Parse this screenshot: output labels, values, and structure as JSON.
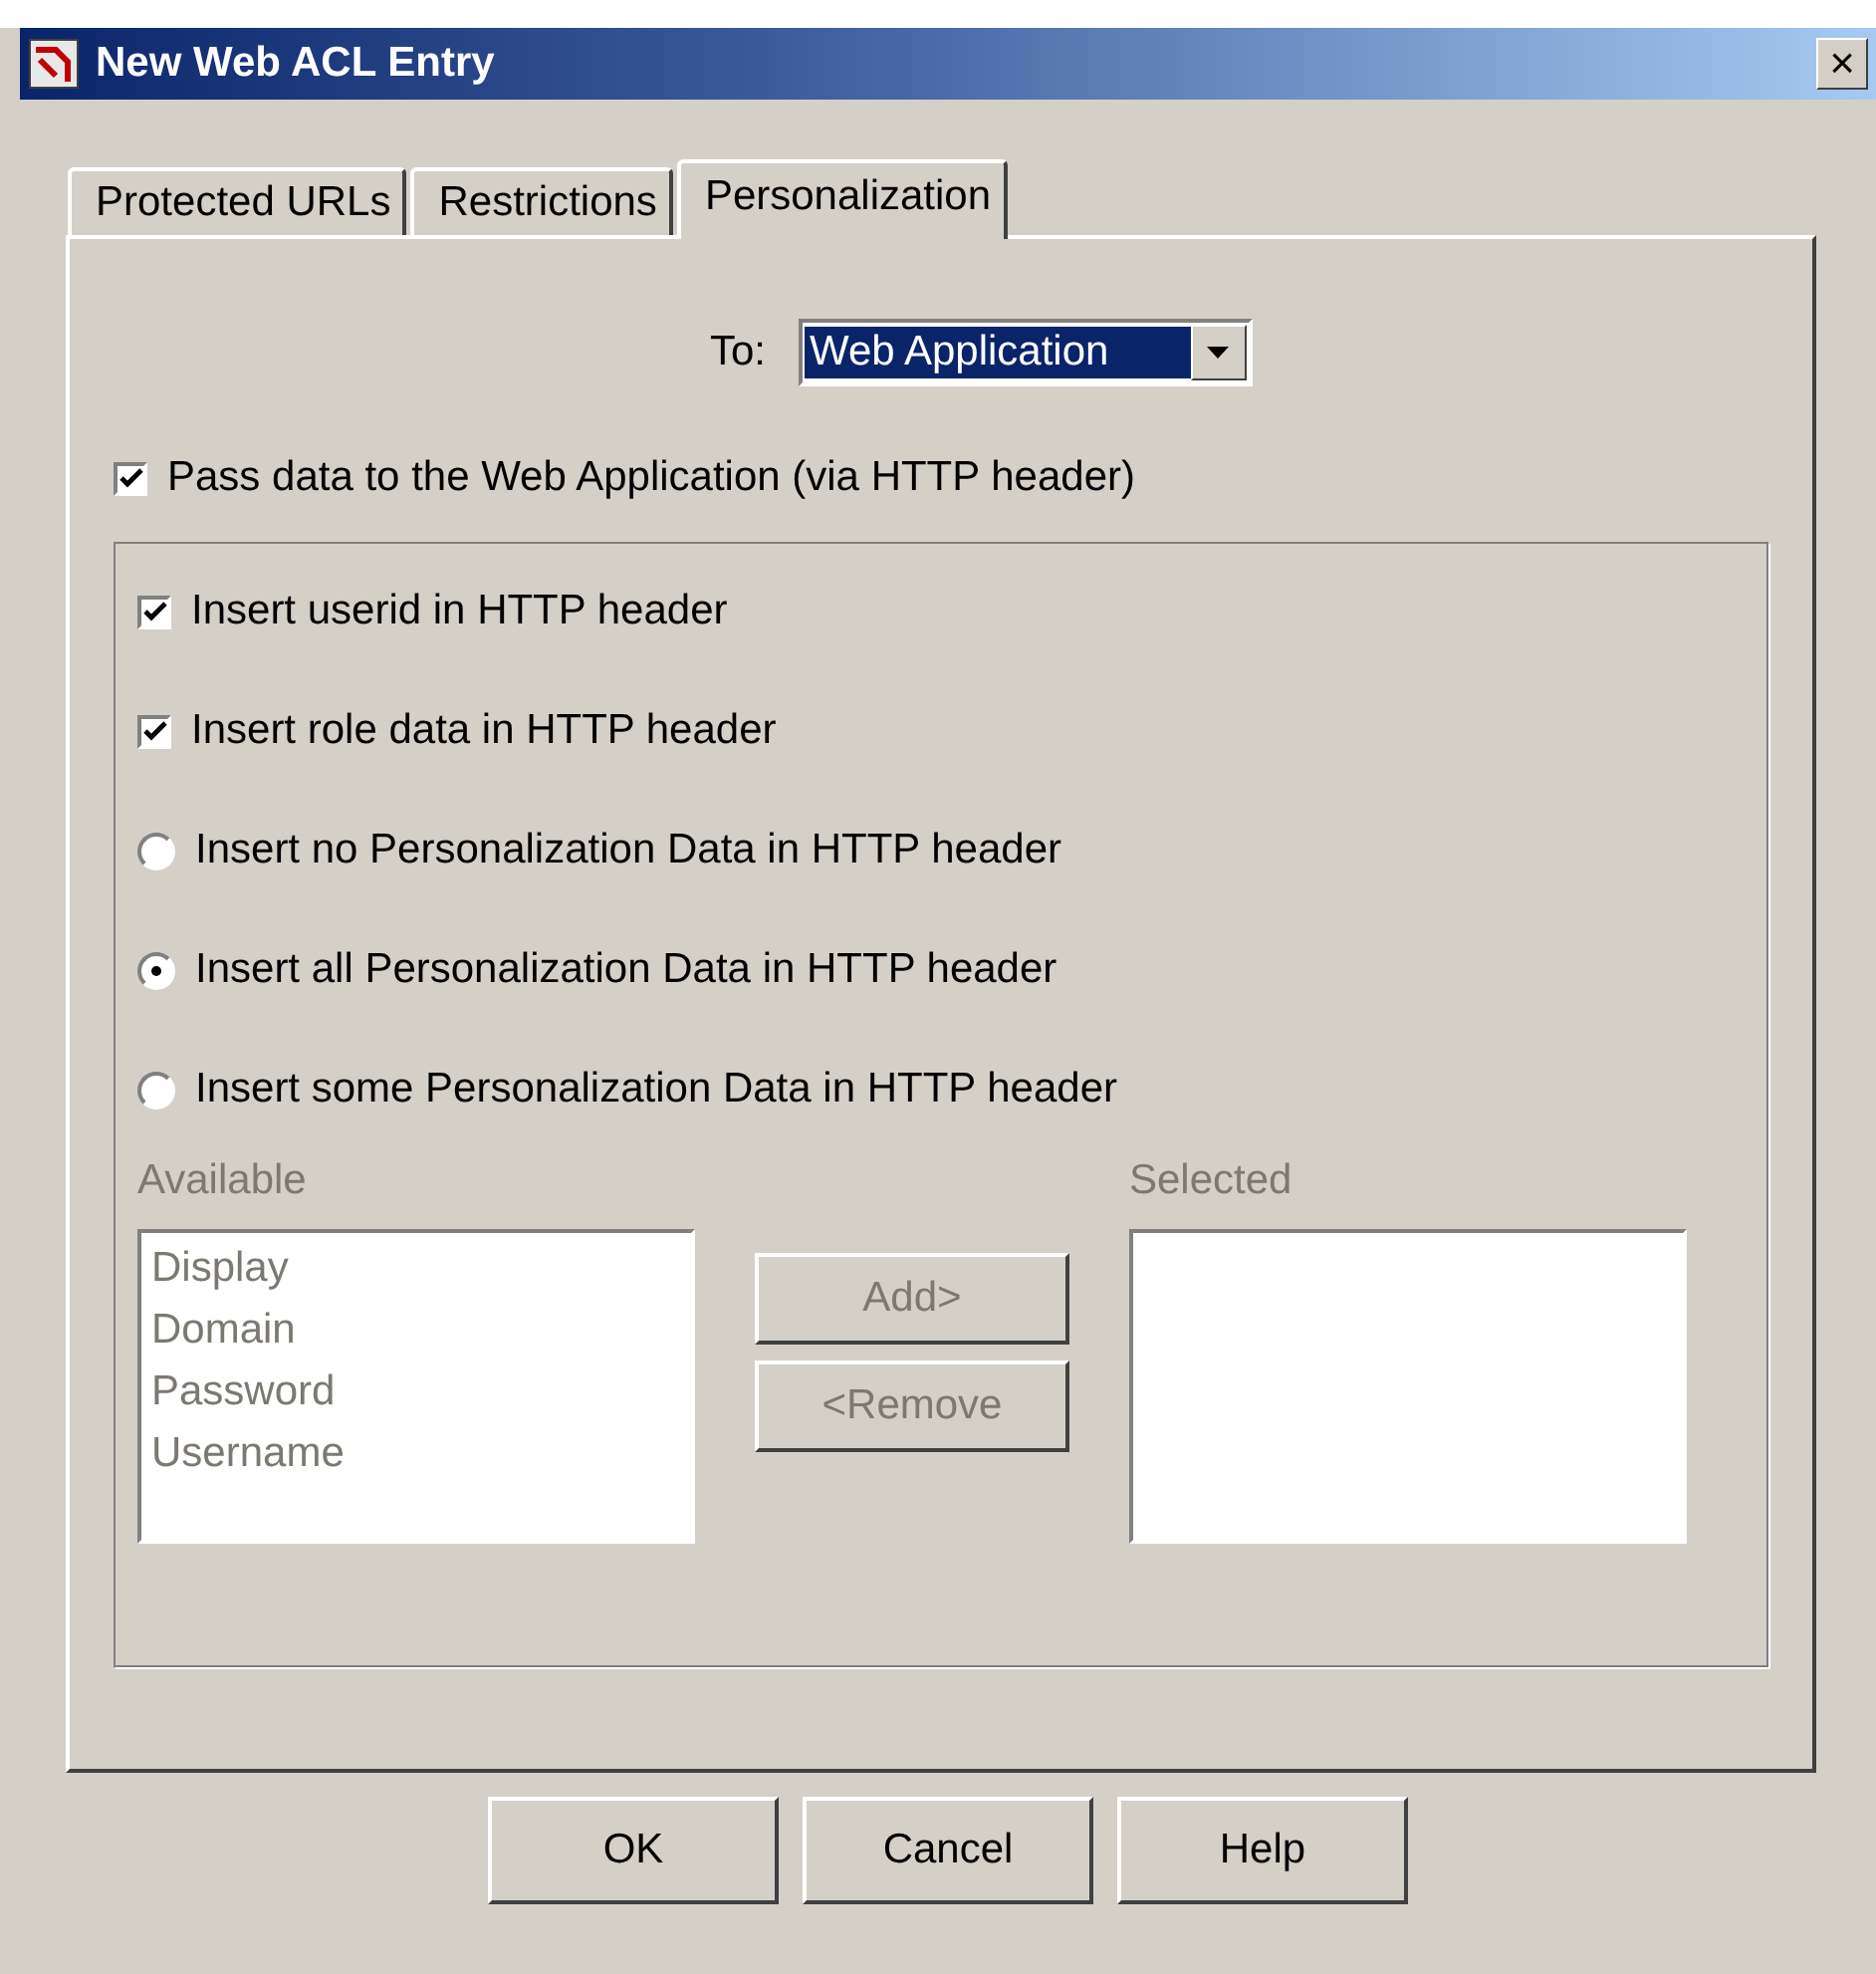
{
  "window": {
    "title": "New Web ACL Entry",
    "close": "×"
  },
  "tabs": [
    {
      "label": "Protected URLs",
      "selected": false
    },
    {
      "label": "Restrictions",
      "selected": false
    },
    {
      "label": "Personalization",
      "selected": true
    }
  ],
  "to": {
    "label": "To:",
    "value": "Web Application"
  },
  "pass_data": {
    "label": "Pass data to the Web Application (via HTTP header)",
    "checked": true
  },
  "options": [
    {
      "kind": "checkbox",
      "label": "Insert userid in HTTP header",
      "checked": true
    },
    {
      "kind": "checkbox",
      "label": "Insert role data in HTTP header",
      "checked": true
    },
    {
      "kind": "radio",
      "label": "Insert no Personalization Data in HTTP header",
      "selected": false
    },
    {
      "kind": "radio",
      "label": "Insert all Personalization Data in HTTP header",
      "selected": true
    },
    {
      "kind": "radio",
      "label": "Insert some Personalization Data in HTTP header",
      "selected": false
    }
  ],
  "picker": {
    "disabled": true,
    "available_label": "Available",
    "available": [
      "Display",
      "Domain",
      "Password",
      "Username"
    ],
    "add": "Add>",
    "remove": "<Remove",
    "selected_label": "Selected"
  },
  "buttons": [
    "OK",
    "Cancel",
    "Help"
  ]
}
